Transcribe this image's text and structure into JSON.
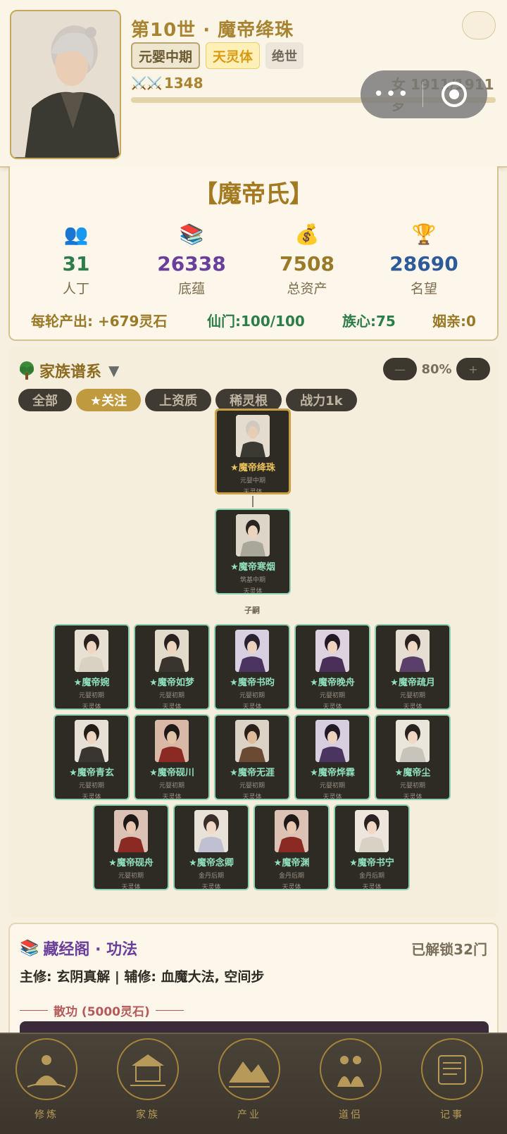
{
  "header": {
    "generation_title": "第10世 · 魔帝绛珠",
    "help_icon": "",
    "realm_tag": "元婴中期",
    "body_tag": "天灵体",
    "talent_tag": "绝世",
    "power_icons": "⚔️⚔️",
    "power_value": "1348",
    "age_text": "女 1911/1911岁",
    "hp_fraction": 1.0
  },
  "clan": {
    "name": "【魔帝氏】",
    "stats": [
      {
        "icon": "people-icon",
        "glyph": "👥",
        "value": "31",
        "label": "人丁"
      },
      {
        "icon": "books-icon",
        "glyph": "📚",
        "value": "26338",
        "label": "底蕴"
      },
      {
        "icon": "money-bag-icon",
        "glyph": "💰",
        "value": "7508",
        "label": "总资产"
      },
      {
        "icon": "trophy-icon",
        "glyph": "🏆",
        "value": "28690",
        "label": "名望"
      }
    ],
    "income": "每轮产出: +679灵石",
    "sect": "仙门:100/100",
    "heart": "族心:75",
    "marriage": "姻亲:0"
  },
  "tree": {
    "title": "家族谱系",
    "toggle_glyph": "▼",
    "zoom_minus": "—",
    "zoom_value": "80%",
    "zoom_plus": "+",
    "filters": [
      "全部",
      "★关注",
      "上资质",
      "稀灵根",
      "战力1k"
    ],
    "active_filter": 1,
    "root": {
      "name": "★魔帝绛珠",
      "realm": "元婴中期",
      "body": "天灵体"
    },
    "parent": {
      "name": "★魔帝寒烟",
      "realm": "筑基中期",
      "body": "天灵体"
    },
    "children_label": "子嗣",
    "children": [
      {
        "name": "★魔帝婉",
        "realm": "元婴初期",
        "body": "天灵体"
      },
      {
        "name": "★魔帝如梦",
        "realm": "元婴初期",
        "body": "天灵体"
      },
      {
        "name": "★魔帝书昀",
        "realm": "元婴初期",
        "body": "天灵体"
      },
      {
        "name": "★魔帝晚舟",
        "realm": "元婴初期",
        "body": "天灵体"
      },
      {
        "name": "★魔帝疏月",
        "realm": "元婴初期",
        "body": "天灵体"
      },
      {
        "name": "★魔帝青玄",
        "realm": "元婴初期",
        "body": "天灵体"
      },
      {
        "name": "★魔帝砚川",
        "realm": "元婴初期",
        "body": "天灵体"
      },
      {
        "name": "★魔帝无涯",
        "realm": "元婴初期",
        "body": "天灵体"
      },
      {
        "name": "★魔帝烨霖",
        "realm": "元婴初期",
        "body": "天灵体"
      },
      {
        "name": "★魔帝尘",
        "realm": "元婴初期",
        "body": "天灵体"
      },
      {
        "name": "★魔帝砚舟",
        "realm": "元婴初期",
        "body": "天灵体"
      },
      {
        "name": "★魔帝念卿",
        "realm": "金丹后期",
        "body": "天灵体"
      },
      {
        "name": "★魔帝渊",
        "realm": "金丹后期",
        "body": "天灵体"
      },
      {
        "name": "★魔帝书宁",
        "realm": "金丹后期",
        "body": "天灵体"
      }
    ]
  },
  "skills": {
    "title": "藏经阁 · 功法",
    "unlocked": "已解锁32门",
    "main": "主修: 玄阴真解 | 辅修: 血魔大法, 空间步",
    "scatter": "散功 (5000灵石)"
  },
  "nav": [
    {
      "icon": "meditation-icon",
      "label": "修炼"
    },
    {
      "icon": "pavilion-icon",
      "label": "家族"
    },
    {
      "icon": "mountain-icon",
      "label": "产业"
    },
    {
      "icon": "couple-icon",
      "label": "道侣"
    },
    {
      "icon": "scroll-icon",
      "label": "记事"
    }
  ],
  "colors": {
    "gold": "#a88431",
    "jade": "#8fe0b8",
    "panel_dark": "#2e2a24",
    "page_bg": "#f7f0e1"
  }
}
